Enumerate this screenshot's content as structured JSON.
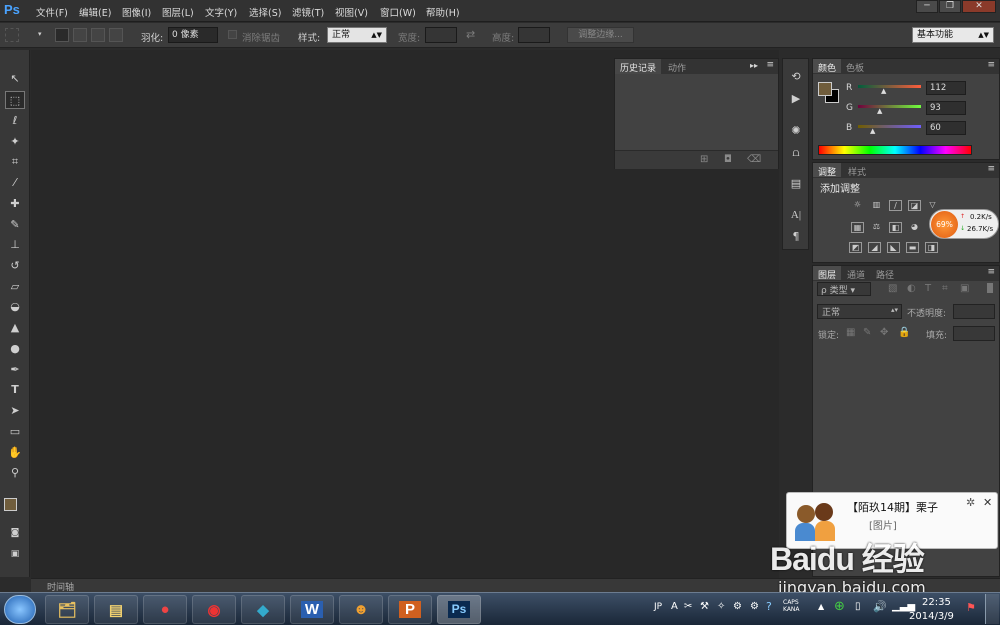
{
  "app": {
    "logo_text": "Ps"
  },
  "menu": [
    "文件(F)",
    "编辑(E)",
    "图像(I)",
    "图层(L)",
    "文字(Y)",
    "选择(S)",
    "滤镜(T)",
    "视图(V)",
    "窗口(W)",
    "帮助(H)"
  ],
  "window_controls": {
    "minimize": "─",
    "restore": "❐",
    "close": "✕"
  },
  "options": {
    "feather_label": "羽化:",
    "feather_value": "0 像素",
    "antialias_label": "消除锯齿",
    "style_label": "样式:",
    "style_value": "正常",
    "width_label": "宽度:",
    "height_label": "高度:",
    "refine_button": "调整边缘...",
    "workspace_value": "基本功能"
  },
  "history_panel": {
    "tabs": [
      "历史记录",
      "动作"
    ]
  },
  "color_panel": {
    "tabs": [
      "颜色",
      "色板"
    ],
    "r_label": "R",
    "r_value": "112",
    "g_label": "G",
    "g_value": "93",
    "b_label": "B",
    "b_value": "60",
    "foreground": "#705d3c"
  },
  "adjust_panel": {
    "tabs": [
      "调整",
      "样式"
    ],
    "title": "添加调整"
  },
  "net_widget": {
    "percent": "69%",
    "up": "0.2K/s",
    "down": "26.7K/s"
  },
  "layers_panel": {
    "tabs": [
      "图层",
      "通道",
      "路径"
    ],
    "filter_label": "ρ 类型",
    "blend_mode": "正常",
    "opacity_label": "不透明度:",
    "lock_label": "锁定:",
    "fill_label": "填充:"
  },
  "timeline": {
    "label": "时间轴"
  },
  "notification": {
    "title": "【陌玖14期】栗子",
    "message": "[图片]"
  },
  "taskbar": {
    "apps": [
      {
        "name": "windows-explorer",
        "glyph": "🗂"
      },
      {
        "name": "chrome",
        "glyph": "●"
      },
      {
        "name": "media-player",
        "glyph": "◉"
      },
      {
        "name": "qq",
        "glyph": "◆"
      },
      {
        "name": "word",
        "glyph": "W"
      },
      {
        "name": "qq-game",
        "glyph": "☻"
      },
      {
        "name": "powerpoint",
        "glyph": "P"
      },
      {
        "name": "photoshop",
        "glyph": "Ps"
      }
    ],
    "ime": "JP",
    "time": "22:35",
    "date": "2014/3/9",
    "tray_text": "CAPS KANA"
  },
  "watermark": {
    "brand": "Baidu 经验",
    "url": "jingyan.baidu.com"
  }
}
